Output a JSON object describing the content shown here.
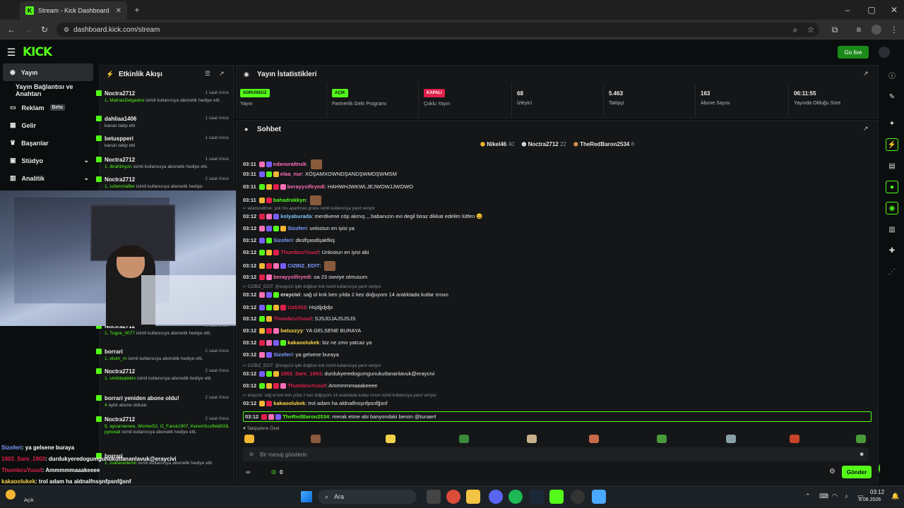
{
  "browser": {
    "tab_title": "Stream - Kick Dashboard",
    "url": "dashboard.kick.com/stream"
  },
  "app": {
    "logo": "KICK",
    "go_live": "Go live"
  },
  "nav": {
    "items": [
      {
        "label": "Yayın",
        "icon": "broadcast-icon"
      },
      {
        "label": "Yayın Bağlantısı ve Anahtarı",
        "icon": ""
      },
      {
        "label": "Reklam",
        "icon": "ad-icon",
        "badge": "Beta"
      },
      {
        "label": "Gelir",
        "icon": "revenue-icon"
      },
      {
        "label": "Başarılar",
        "icon": "trophy-icon"
      },
      {
        "label": "Stüdyo",
        "icon": "studio-icon"
      },
      {
        "label": "Analitik",
        "icon": "analytics-icon"
      }
    ]
  },
  "events": {
    "title": "Etkinlik Akışı",
    "items": [
      {
        "name": "Noctra2712",
        "time": "1 saat önce",
        "desc_user": "1, MatriasDelgadoo",
        "desc": "isimli kullanıcıya abonelik hediye etti."
      },
      {
        "name": "dahliaa1406",
        "time": "1 saat önce",
        "desc_user": "",
        "desc": "kanalı takip etti"
      },
      {
        "name": "betuspperi",
        "time": "1 saat önce",
        "desc_user": "",
        "desc": "kanalı takip etti"
      },
      {
        "name": "Noctra2712",
        "time": "1 saat önce",
        "desc_user": "1, ibrahimyzn",
        "desc": "isimli kullanıcıya abonelik hediye etti."
      },
      {
        "name": "Noctra2712",
        "time": "2 saat önce",
        "desc_user": "1, ozlemmafter",
        "desc": "isimli kullanıcıya abonelik hediye"
      },
      {
        "name": "Noctra2712",
        "time": "2 saat önce",
        "desc_user": "1, Tugce_0077",
        "desc": "isimli kullanıcıya abonelik hediye etti."
      },
      {
        "name": "borrari",
        "time": "2 saat önce",
        "desc_user": "1, elsim_m",
        "desc": "isimli kullanıcıya abonelik hediye etti."
      },
      {
        "name": "Noctra2712",
        "time": "2 saat önce",
        "desc_user": "1, umitdaqtekin",
        "desc": "isimli kullanıcıya abonelik hediye etti."
      },
      {
        "name": "borrari yeniden abone oldu!",
        "time": "2 saat önce",
        "desc_user": "4",
        "desc": "aylık abone oldular"
      },
      {
        "name": "Noctra2712",
        "time": "2 saat önce",
        "desc_user": "5, aycarraenee, Womer52, O_Faruk1907, KeremScofield028, pyrexali",
        "desc": "isimli kullanıcıya abonelik hediye etti."
      },
      {
        "name": "borrari",
        "time": "",
        "desc_user": "1, maheredemir",
        "desc": "isimli kullanıcıya abonelik hediye etti."
      }
    ]
  },
  "stats": {
    "title": "Yayın İstatistikleri",
    "items": [
      {
        "pill": "SORUNSUZ",
        "pill_color": "#53fc18",
        "label": "Yayın"
      },
      {
        "pill": "AÇIK",
        "pill_color": "#53fc18",
        "label": "Partnerlik Gelir Programı"
      },
      {
        "pill": "KAPALI",
        "pill_color": "#e0204a",
        "label": "Çoklu Yayın"
      },
      {
        "value": "68",
        "label": "İzleyici"
      },
      {
        "value": "5.463",
        "label": "Takipçi"
      },
      {
        "value": "163",
        "label": "Abone Sayısı"
      },
      {
        "value": "06:11:55",
        "label": "Yayında Olduğu Süre"
      }
    ]
  },
  "chat": {
    "title": "Sohbet",
    "top_gifters": [
      {
        "name": "Nikel46",
        "count": "40"
      },
      {
        "name": "Noctra2712",
        "count": "22"
      },
      {
        "name": "TheRedBaron2534",
        "count": "8"
      }
    ],
    "messages": [
      {
        "time": "03:11",
        "user": "edanuraltnsk",
        "color": "#ff6fb5",
        "text": ""
      },
      {
        "time": "03:11",
        "user": "elaa_nur",
        "color": "#ff6fb5",
        "text": "XÖŞAMXOWNDŞANDŞWMDŞWMSM"
      },
      {
        "time": "03:11",
        "user": "berayysifiryedi",
        "color": "#ff6fb5",
        "text": "HAHWHJWKWLJEJWOWJJWOWO"
      },
      {
        "time": "03:11",
        "user": "bahadrakkyn",
        "color": "#53fc18",
        "text": ""
      },
      {
        "time": "03:12",
        "user": "kolyaburada",
        "color": "#7ec8ff",
        "text": "merdivene cöp akmış ,, babanızın evi degil biraz dikkat edelim lütfen 😀",
        "reply": "edanuraltnsk: yok mu apartman grubu isimli kullanıcıya yanıt veriyor"
      },
      {
        "time": "03:12",
        "user": "Sizoferi",
        "color": "#7e9cff",
        "text": "unlostun en iyisi ya"
      },
      {
        "time": "03:12",
        "user": "Sizoferi",
        "color": "#7e9cff",
        "text": "dkslfşasdlşakfkiş"
      },
      {
        "time": "03:12",
        "user": "ThumbcuYusuf",
        "color": "#e0204a",
        "text": "Unlostun en iyisi abi"
      },
      {
        "time": "03:12",
        "user": "CIZBIZ_EDIT",
        "color": "#7e9cff",
        "text": ""
      },
      {
        "time": "03:12",
        "user": "berayysifiryedi",
        "color": "#ff6fb5",
        "text": "oa 23 swviye olmusum"
      },
      {
        "time": "03:12",
        "user": "eraycivi",
        "color": "#e6e6e6",
        "text": "sağ ol knk ben yılda 2 kez doğuyom 14 aralıktada kutlar mısın",
        "reply": "CIZBIZ_EDIT: @eraycivi iyiki doğdun knk isimli kullanıcıya yanıt veriyor"
      },
      {
        "time": "03:12",
        "user": "Ua5353",
        "color": "#e0204a",
        "text": "Hsjdjjdjdjx"
      },
      {
        "time": "03:12",
        "user": "ThumbcuYusuf",
        "color": "#e0204a",
        "text": "SJSJDJAJSJSJS"
      },
      {
        "time": "03:12",
        "user": "batuzzyy",
        "color": "#ffd54a",
        "text": "YA GELSENE BURAYA"
      },
      {
        "time": "03:12",
        "user": "kakaoolukek",
        "color": "#ffd54a",
        "text": "biz ne zmn yatcaz ya"
      },
      {
        "time": "03:12",
        "user": "Sizoferi",
        "color": "#7e9cff",
        "text": "ya gelsene buraya"
      },
      {
        "time": "03:12",
        "user": "1903_Sare_1903",
        "color": "#e0204a",
        "text": "durdukyeredogumgunukutlananlavuk@eraycivi",
        "reply": "CIZBIZ_EDIT: @eraycivi iyiki doğdun knk isimli kullanıcıya yanıt veriyor"
      },
      {
        "time": "03:12",
        "user": "ThumbcuYusuf",
        "color": "#e0204a",
        "text": "Ammmmmaaakeeee"
      },
      {
        "time": "03:12",
        "user": "kakaoolukek",
        "color": "#ffd54a",
        "text": "trol adam ha aldnalfnsşnfpsnfğsnf",
        "reply": "eraycivi: sağ ol knk ben yılda 2 kez doğuyom 14 aralıktada kutlar mısın isimli kullanıcıya yanıt veriyor"
      },
      {
        "time": "03:12",
        "user": "TheRedBaron2534",
        "color": "#53fc18",
        "text": "merak etme abi banyondaki benim @tunaerl"
      }
    ],
    "emote_section": "Takipçilere Özel",
    "input_placeholder": "Bir mesaj gönderin",
    "send": "Gönder",
    "footer_count": "0"
  },
  "overlay_chat": [
    {
      "user": "Sizoferi",
      "text": "ya gelsene buraya",
      "color": "#7e9cff"
    },
    {
      "user": "1903_Sare_1903",
      "text": "durdukyeredogumgunukutlananlavuk@eraycivi",
      "color": "#e0204a"
    },
    {
      "user": "ThumbcuYusuf",
      "text": "Ammmmmaaakeeee",
      "color": "#e0204a"
    },
    {
      "user": "kakaoolukek",
      "text": "trol adam ha aldnalfnsşnfpsnfğsnf",
      "color": "#ffd54a"
    },
    {
      "user": "TheRedBaron2534",
      "text": "merak etme abi banyondaki benim @tunaerl",
      "color": "#53fc18"
    }
  ],
  "taskbar": {
    "search": "Ara",
    "time": "03:12",
    "date": "8.08.2026",
    "weather_label": "Açık"
  }
}
